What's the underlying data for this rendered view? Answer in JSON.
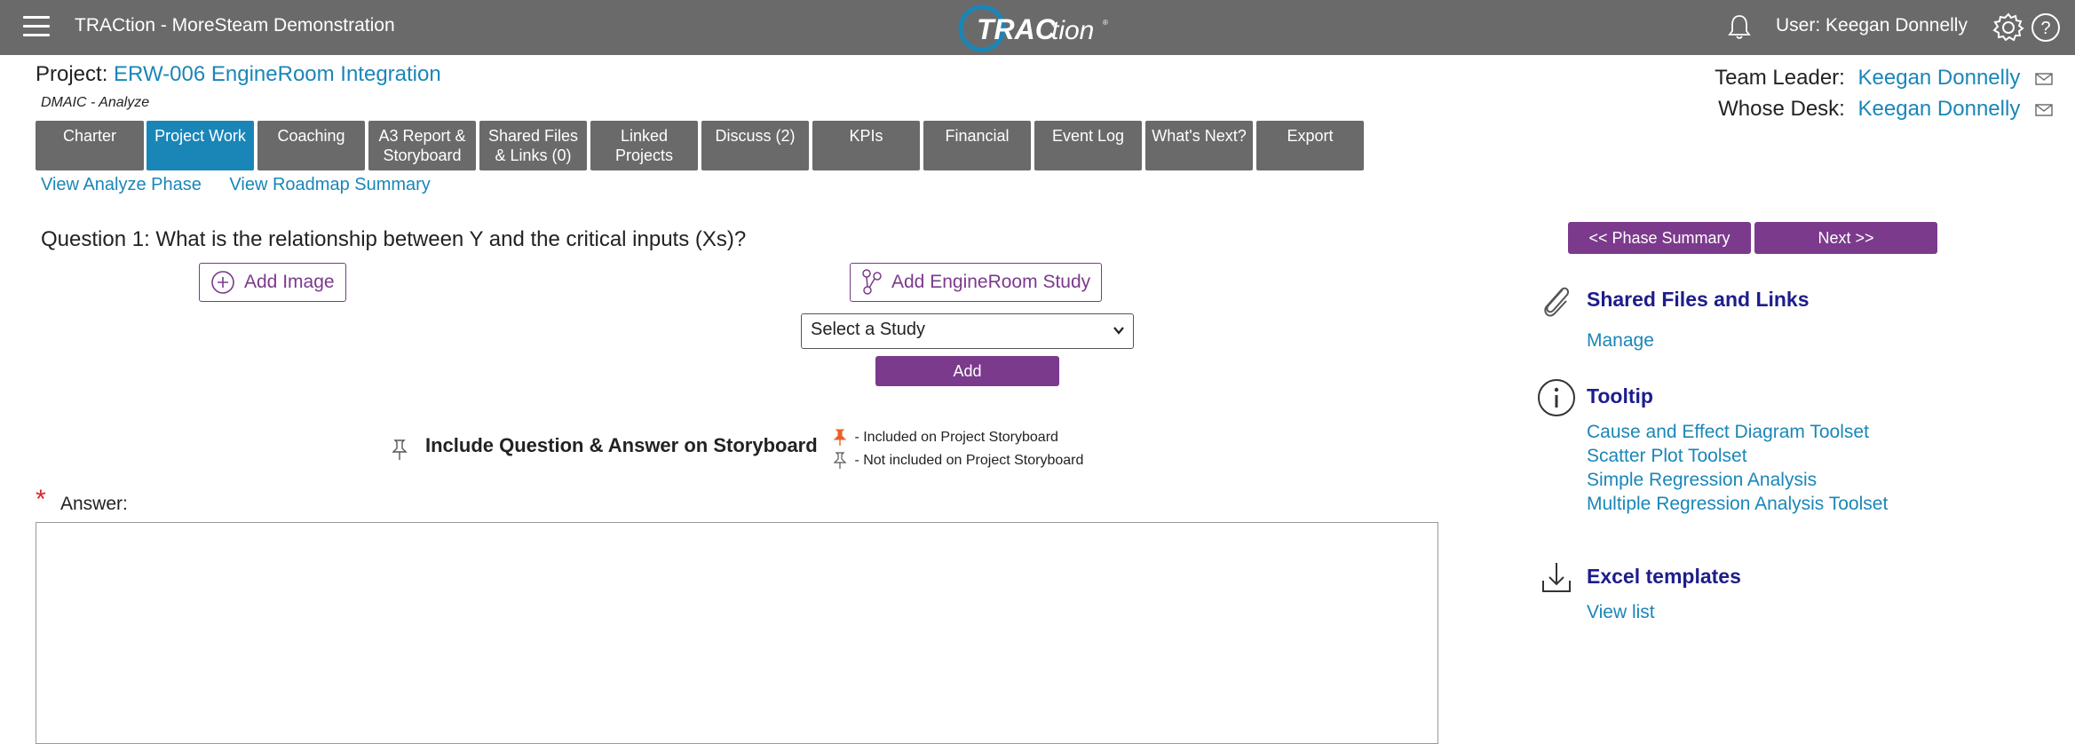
{
  "topbar": {
    "app_title": "TRACtion - MoreSteam Demonstration",
    "logo_text": "TRACtion",
    "user_label": "User: Keegan Donnelly"
  },
  "project": {
    "prefix": "Project:",
    "name": "ERW-006 EngineRoom Integration",
    "phase": "DMAIC - Analyze",
    "team_leader_label": "Team Leader:",
    "team_leader": "Keegan Donnelly",
    "whose_desk_label": "Whose Desk:",
    "whose_desk": "Keegan Donnelly"
  },
  "tabs": [
    {
      "line1": "Charter",
      "line2": ""
    },
    {
      "line1": "Project Work",
      "line2": ""
    },
    {
      "line1": "Coaching",
      "line2": ""
    },
    {
      "line1": "A3 Report &",
      "line2": "Storyboard"
    },
    {
      "line1": "Shared Files",
      "line2": "& Links (0)"
    },
    {
      "line1": "Linked",
      "line2": "Projects"
    },
    {
      "line1": "Discuss (2)",
      "line2": ""
    },
    {
      "line1": "KPIs",
      "line2": ""
    },
    {
      "line1": "Financial",
      "line2": ""
    },
    {
      "line1": "Event Log",
      "line2": ""
    },
    {
      "line1": "What's Next?",
      "line2": ""
    },
    {
      "line1": "Export",
      "line2": ""
    }
  ],
  "sublinks": {
    "view_phase": "View Analyze Phase",
    "view_roadmap": "View Roadmap Summary"
  },
  "question": {
    "text": "Question 1: What is the relationship between Y and the critical inputs (Xs)?",
    "add_image": "Add Image",
    "add_study": "Add EngineRoom Study",
    "select_study": "Select a Study",
    "add_button": "Add",
    "storyboard_label": "Include Question & Answer on Storyboard",
    "legend_included": "- Included on Project Storyboard",
    "legend_not_included": "- Not included on Project Storyboard",
    "answer_label": "Answer:",
    "required_mark": "*"
  },
  "nav": {
    "prev": "<< Phase Summary",
    "next": "Next >>"
  },
  "panel": {
    "shared_title": "Shared Files and Links",
    "manage": "Manage",
    "tooltip_title": "Tooltip",
    "tooltip_links": [
      "Cause and Effect Diagram Toolset",
      "Scatter Plot Toolset",
      "Simple Regression Analysis",
      "Multiple Regression Analysis Toolset"
    ],
    "excel_title": "Excel templates",
    "view_list": "View list"
  },
  "colors": {
    "topbar": "#6a6a6a",
    "active_tab": "#1a86b8",
    "purple": "#7b3a8c",
    "link": "#1a86b8",
    "panel_title": "#1d1d8c",
    "pin_orange": "#e8622a"
  }
}
